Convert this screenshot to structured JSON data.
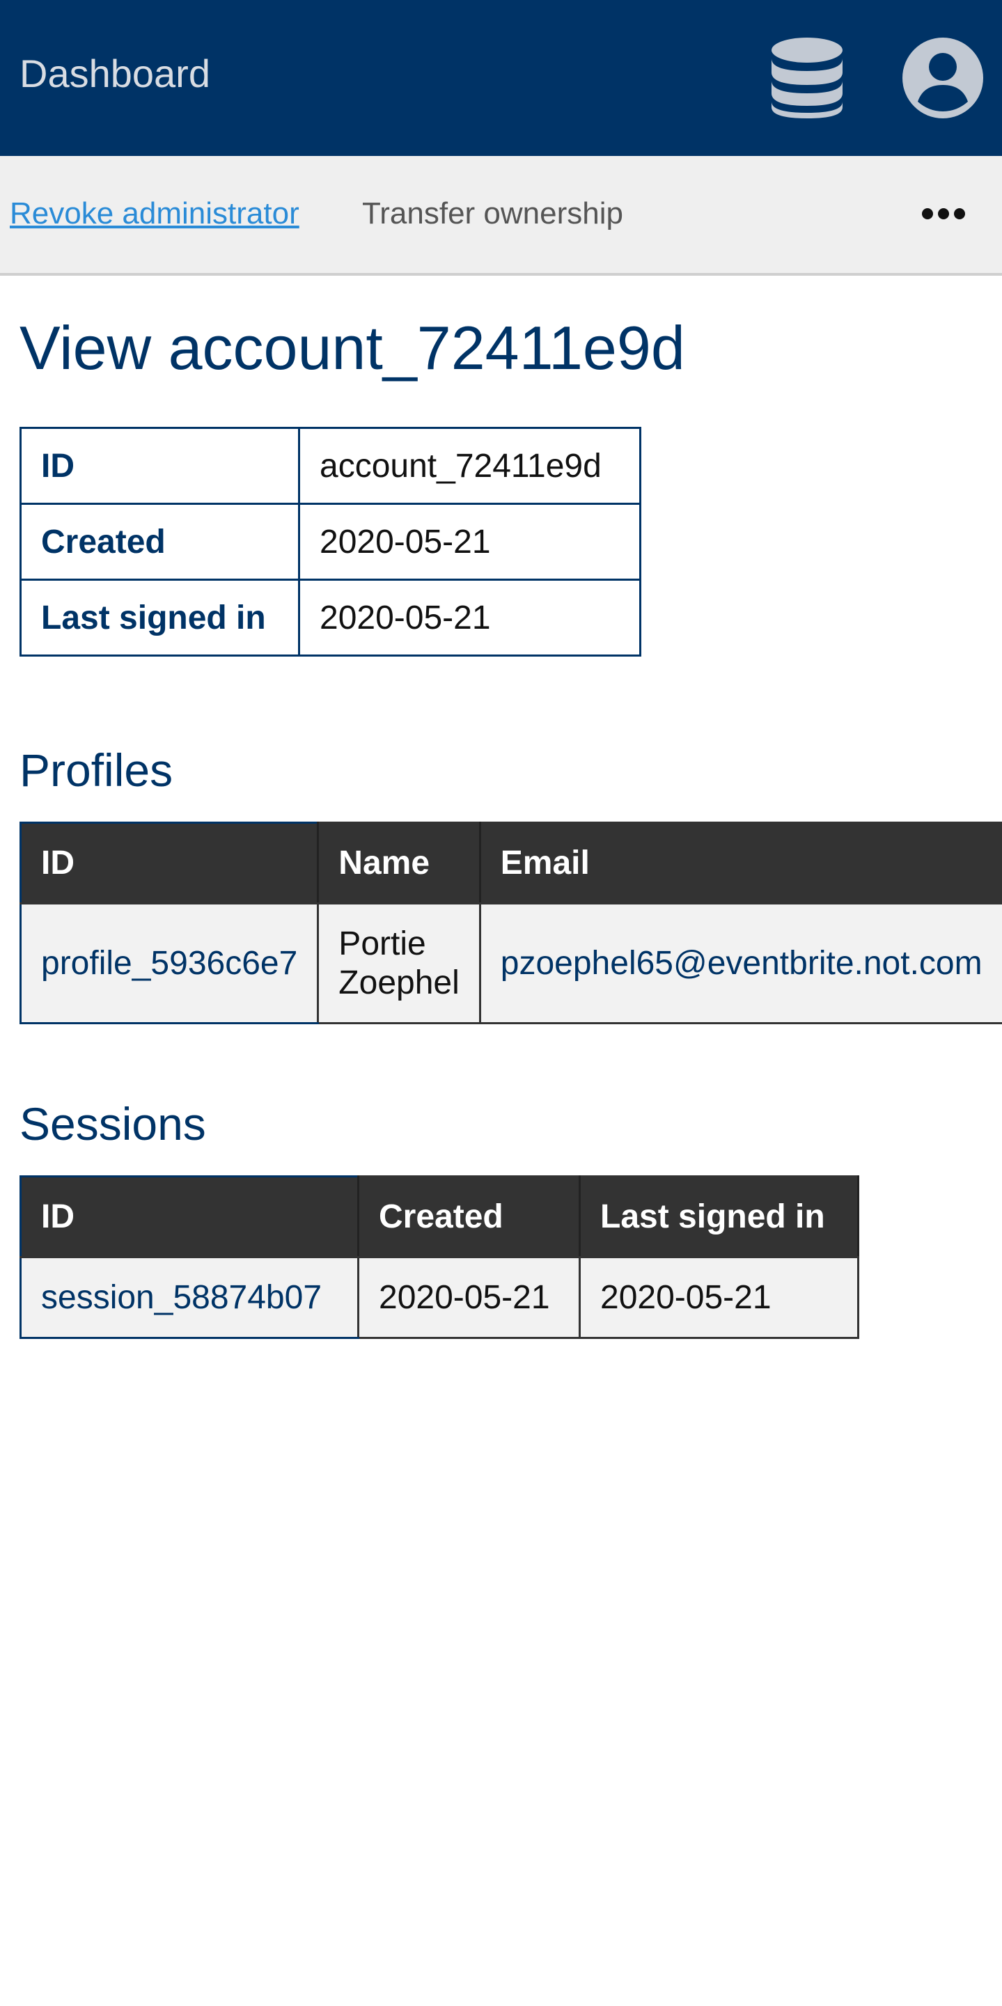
{
  "header": {
    "brand": "Dashboard",
    "icons": [
      "database-icon",
      "user-account-icon"
    ]
  },
  "actions": {
    "revoke_admin": "Revoke administrator",
    "transfer_ownership": "Transfer ownership",
    "more_icon": "more-horizontal-icon"
  },
  "page": {
    "title": "View account_72411e9d"
  },
  "account": {
    "rows": [
      {
        "label": "ID",
        "value": "account_72411e9d"
      },
      {
        "label": "Created",
        "value": "2020-05-21"
      },
      {
        "label": "Last signed in",
        "value": "2020-05-21"
      }
    ]
  },
  "profiles": {
    "title": "Profiles",
    "columns": [
      "ID",
      "Name",
      "Email"
    ],
    "rows": [
      {
        "id": "profile_5936c6e7",
        "name_line1": "Portie",
        "name_line2": "Zoephel",
        "email": "pzoephel65@eventbrite.not.com"
      }
    ]
  },
  "sessions": {
    "title": "Sessions",
    "columns": [
      "ID",
      "Created",
      "Last signed in"
    ],
    "rows": [
      {
        "id": "session_58874b07",
        "created": "2020-05-21",
        "last_signed_in": "2020-05-21"
      }
    ]
  },
  "colors": {
    "navy": "#003366",
    "link_blue": "#2a8bd7",
    "header_dark": "#333333",
    "row_bg": "#f2f2f2"
  }
}
